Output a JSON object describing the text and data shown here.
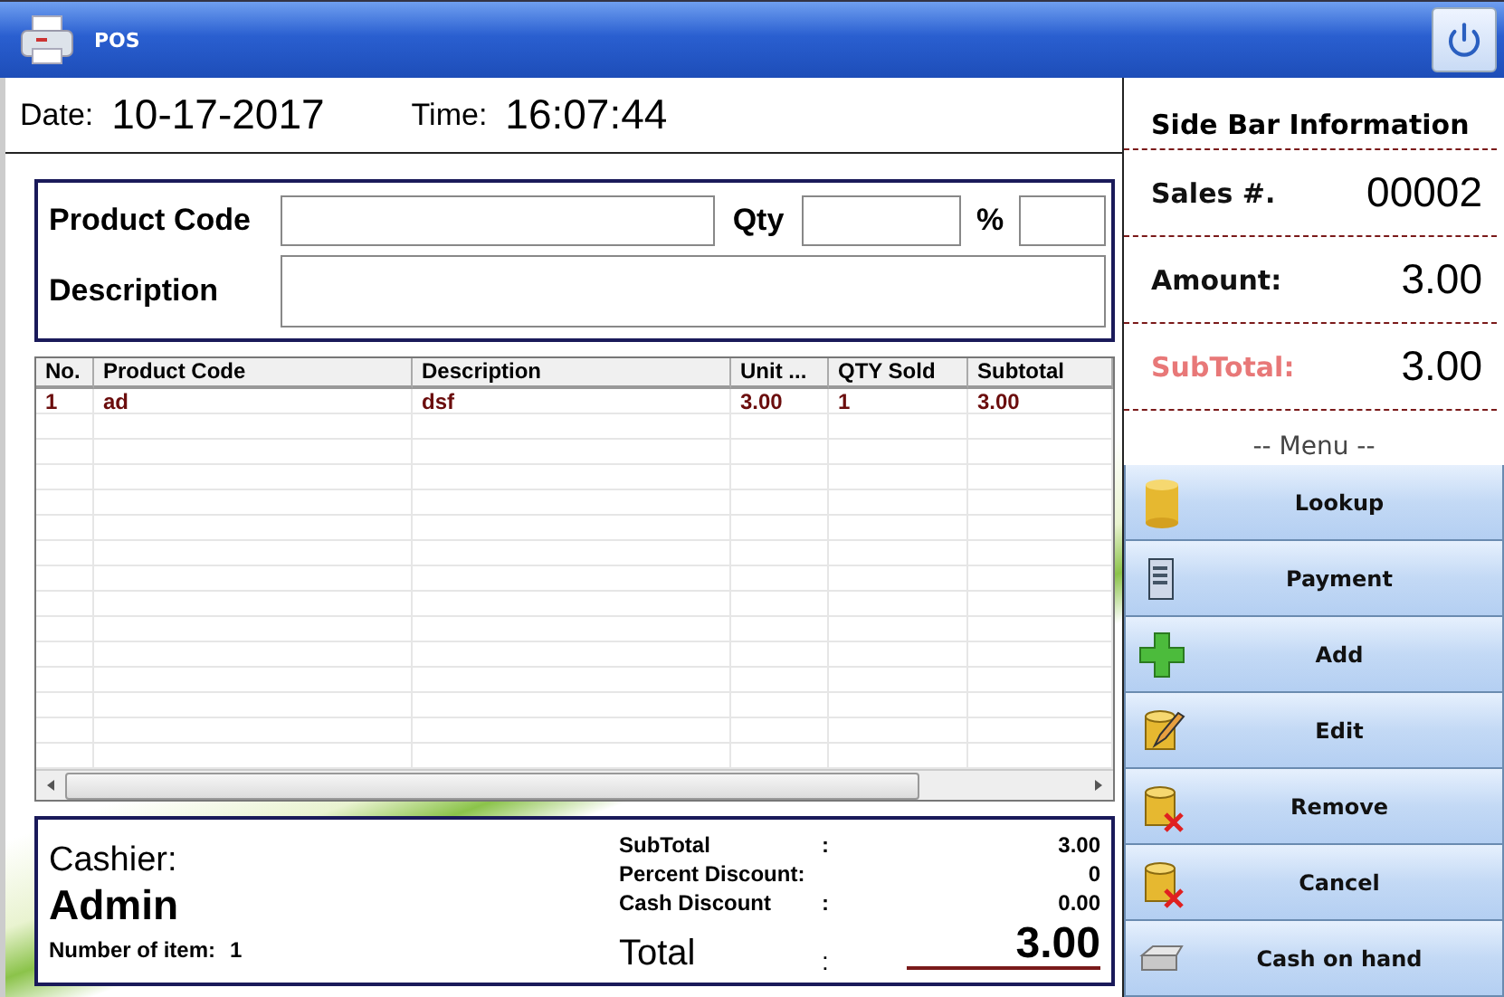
{
  "window": {
    "title": "POS"
  },
  "header": {
    "date_label": "Date:",
    "date": "10-17-2017",
    "time_label": "Time:",
    "time": "16:07:44"
  },
  "entry": {
    "product_code_label": "Product Code",
    "qty_label": "Qty",
    "percent_label": "%",
    "description_label": "Description"
  },
  "table": {
    "columns": [
      "No.",
      "Product Code",
      "Description",
      "Unit ...",
      "QTY Sold",
      "Subtotal"
    ],
    "rows": [
      [
        "1",
        "ad",
        "dsf",
        "3.00",
        "1",
        "3.00"
      ]
    ]
  },
  "summary": {
    "cashier_label": "Cashier:",
    "cashier": "Admin",
    "items_label": "Number of item:",
    "items": "1",
    "lines": [
      {
        "label": "SubTotal",
        "colon": ":",
        "value": "3.00"
      },
      {
        "label": "Percent Discount:",
        "value": "0"
      },
      {
        "label": "Cash Discount",
        "colon": ":",
        "value": "0.00"
      }
    ],
    "total_label": "Total",
    "total_colon": ":",
    "total": "3.00"
  },
  "sidebar": {
    "title": "Side Bar Information",
    "rows": [
      {
        "label": "Sales #.",
        "value": "00002",
        "kind": "normal"
      },
      {
        "label": "Amount:",
        "value": "3.00",
        "kind": "normal"
      },
      {
        "label": "SubTotal:",
        "value": "3.00",
        "kind": "highlight"
      }
    ],
    "menu_label": "-- Menu --",
    "buttons": [
      {
        "label": "Lookup"
      },
      {
        "label": "Payment"
      },
      {
        "label": "Add"
      },
      {
        "label": "Edit"
      },
      {
        "label": "Remove"
      },
      {
        "label": "Cancel"
      },
      {
        "label": "Cash on hand"
      }
    ]
  }
}
